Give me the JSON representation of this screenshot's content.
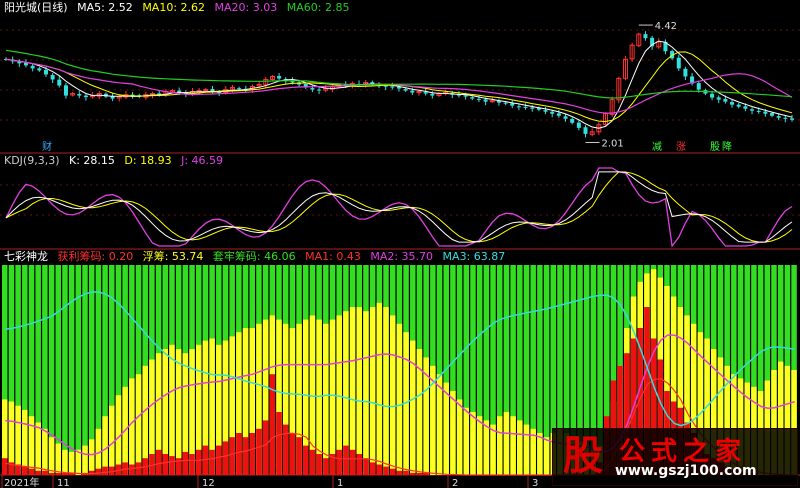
{
  "colors": {
    "up": "#ff3333",
    "down": "#33e0e0",
    "ma5": "#ffffff",
    "ma10": "#ffff00",
    "ma20": "#e040e0",
    "ma60": "#22cc22",
    "kdj_k": "#ffffff",
    "kdj_d": "#ffff00",
    "kdj_j": "#e040e0",
    "green": "#33dd22",
    "yellow": "#ffff22",
    "red": "#ee1111",
    "ma1": "#ff3030",
    "ma2": "#e040e0",
    "ma3": "#33dddd"
  },
  "panel1": {
    "title": "阳光城(日线)",
    "legend": [
      {
        "label": "MA5: 2.52",
        "color": "#ffffff"
      },
      {
        "label": "MA10: 2.62",
        "color": "#ffff00"
      },
      {
        "label": "MA20: 3.03",
        "color": "#e040e0"
      },
      {
        "label": "MA60: 2.85",
        "color": "#22cc22"
      }
    ],
    "high_label": "4.42",
    "low_label": "2.01",
    "markers": [
      {
        "text": "财",
        "color": "#33aaff"
      },
      {
        "text": "减",
        "color": "#33ff33"
      },
      {
        "text": "涨",
        "color": "#ff3333"
      },
      {
        "text": "股",
        "color": "#33ff33"
      },
      {
        "text": "降",
        "color": "#33ff33"
      }
    ]
  },
  "panel2": {
    "title": "KDJ(9,3,3)",
    "legend": [
      {
        "label": "K: 28.15",
        "color": "#ffffff"
      },
      {
        "label": "D: 18.93",
        "color": "#ffff00"
      },
      {
        "label": "J: 46.59",
        "color": "#e040e0"
      }
    ]
  },
  "panel3": {
    "title": "七彩神龙",
    "legend": [
      {
        "label": "获利筹码: 0.20",
        "color": "#ff3030"
      },
      {
        "label": "浮筹: 53.74",
        "color": "#ffff22"
      },
      {
        "label": "套牢筹码: 46.06",
        "color": "#33dd22"
      },
      {
        "label": "MA1: 0.43",
        "color": "#ff3030"
      },
      {
        "label": "MA2: 35.70",
        "color": "#e040e0"
      },
      {
        "label": "MA3: 63.87",
        "color": "#33dddd"
      }
    ]
  },
  "x_axis": {
    "labels": [
      "2021年",
      "11",
      "12",
      "1",
      "2",
      "3"
    ]
  },
  "watermark": {
    "logo": "股",
    "title": "公式之家",
    "url": "www.gszj100.com"
  },
  "chart_data": [
    {
      "type": "candlestick",
      "title": "阳光城(日线)",
      "ylim": [
        1.9,
        4.6
      ],
      "high": 4.42,
      "low": 2.01,
      "close_series": [
        3.7,
        3.66,
        3.62,
        3.58,
        3.52,
        3.48,
        3.4,
        3.3,
        3.18,
        2.98,
        3.02,
        2.98,
        2.95,
        2.98,
        3.02,
        2.96,
        2.92,
        2.96,
        3.0,
        2.98,
        2.96,
        3.0,
        3.02,
        3.0,
        3.06,
        3.08,
        3.04,
        3.02,
        3.06,
        3.08,
        3.1,
        3.06,
        3.04,
        3.1,
        3.14,
        3.12,
        3.1,
        3.16,
        3.2,
        3.3,
        3.36,
        3.32,
        3.28,
        3.24,
        3.2,
        3.14,
        3.1,
        3.08,
        3.12,
        3.16,
        3.2,
        3.18,
        3.22,
        3.2,
        3.24,
        3.2,
        3.18,
        3.16,
        3.14,
        3.12,
        3.08,
        3.04,
        3.06,
        3.02,
        2.98,
        3.02,
        3.04,
        3.0,
        2.98,
        2.96,
        2.92,
        2.9,
        2.86,
        2.88,
        2.84,
        2.82,
        2.78,
        2.76,
        2.74,
        2.72,
        2.7,
        2.66,
        2.62,
        2.58,
        2.52,
        2.44,
        2.34,
        2.22,
        2.26,
        2.4,
        2.62,
        2.9,
        3.32,
        3.7,
        3.98,
        4.2,
        4.12,
        3.96,
        4.05,
        3.86,
        3.72,
        3.52,
        3.36,
        3.22,
        3.1,
        3.02,
        2.94,
        2.9,
        2.86,
        2.8,
        2.76,
        2.72,
        2.68,
        2.66,
        2.62,
        2.58,
        2.54,
        2.52,
        2.5
      ],
      "ma5": 2.52,
      "ma10": 2.62,
      "ma20": 3.03,
      "ma60": 2.85
    },
    {
      "type": "line",
      "title": "KDJ(9,3,3)",
      "ylim": [
        0,
        100
      ],
      "series": [
        {
          "name": "K",
          "last": 28.15
        },
        {
          "name": "D",
          "last": 18.93
        },
        {
          "name": "J",
          "last": 46.59
        }
      ]
    },
    {
      "type": "bar",
      "title": "七彩神龙",
      "ylim": [
        0,
        100
      ],
      "stacked": true,
      "series": [
        {
          "name": "获利筹码",
          "last": 0.2
        },
        {
          "name": "浮筹",
          "last": 53.74
        },
        {
          "name": "套牢筹码",
          "last": 46.06
        }
      ],
      "red_values": [
        8,
        6,
        5,
        4,
        3,
        2,
        2,
        1,
        1,
        1,
        1,
        0,
        1,
        2,
        3,
        4,
        4,
        5,
        6,
        5,
        6,
        8,
        10,
        12,
        10,
        9,
        8,
        11,
        10,
        12,
        14,
        12,
        14,
        16,
        18,
        20,
        18,
        20,
        22,
        26,
        48,
        30,
        24,
        20,
        18,
        14,
        12,
        10,
        8,
        10,
        12,
        14,
        12,
        10,
        8,
        6,
        5,
        4,
        3,
        2,
        2,
        1,
        1,
        1,
        0,
        0,
        0,
        0,
        0,
        0,
        0,
        0,
        0,
        0,
        0,
        0,
        0,
        0,
        0,
        0,
        0,
        0,
        0,
        0,
        0,
        0,
        0,
        0,
        0,
        6,
        28,
        45,
        52,
        58,
        65,
        70,
        80,
        65,
        55,
        40,
        35,
        32,
        25,
        20,
        15,
        10,
        8,
        6,
        4,
        3,
        2,
        1,
        1,
        0,
        0,
        0,
        0,
        0,
        0
      ],
      "yellow_top": [
        36,
        35,
        33,
        31,
        28,
        25,
        22,
        18,
        15,
        12,
        11,
        12,
        14,
        17,
        22,
        28,
        33,
        38,
        42,
        46,
        48,
        52,
        55,
        58,
        60,
        62,
        60,
        58,
        60,
        62,
        64,
        65,
        62,
        64,
        66,
        68,
        70,
        70,
        72,
        74,
        76,
        74,
        72,
        70,
        72,
        74,
        76,
        74,
        72,
        74,
        76,
        78,
        80,
        80,
        78,
        80,
        82,
        80,
        76,
        72,
        68,
        64,
        60,
        56,
        52,
        48,
        44,
        40,
        36,
        32,
        30,
        28,
        26,
        24,
        28,
        30,
        28,
        26,
        24,
        22,
        20,
        18,
        20,
        22,
        20,
        18,
        16,
        14,
        12,
        14,
        20,
        35,
        52,
        70,
        85,
        92,
        96,
        98,
        94,
        90,
        85,
        80,
        76,
        72,
        68,
        65,
        60,
        56,
        52,
        48,
        46,
        44,
        42,
        40,
        45,
        50,
        54,
        52,
        50
      ],
      "ma1_last": 0.43,
      "ma2_last": 35.7,
      "ma3_last": 63.87
    }
  ]
}
